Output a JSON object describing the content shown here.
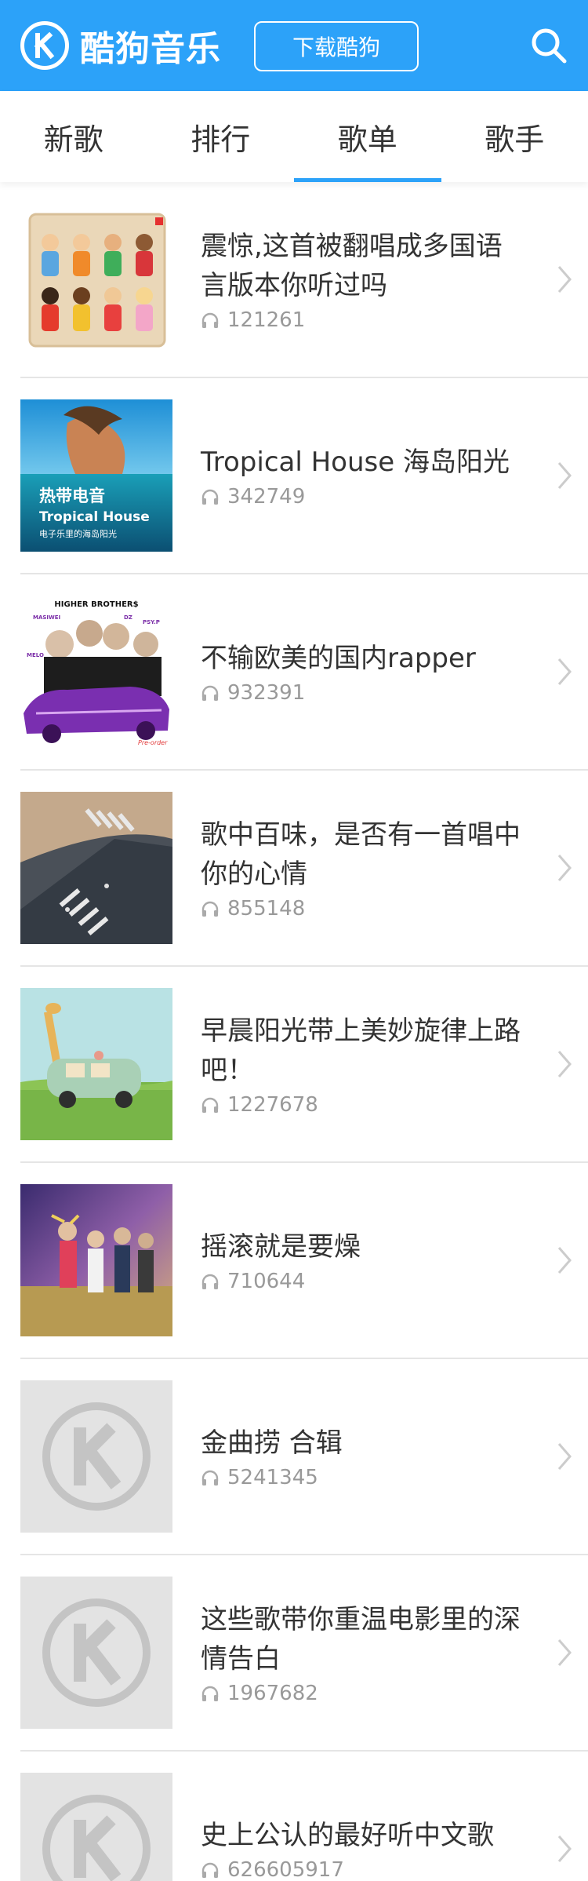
{
  "header": {
    "app_name": "酷狗音乐",
    "download_label": "下载酷狗",
    "brand_color": "#2ca2f9",
    "logo_icon": "kugou-logo-icon",
    "search_icon": "search-icon"
  },
  "tabs": [
    {
      "label": "新歌",
      "active": false
    },
    {
      "label": "排行",
      "active": false
    },
    {
      "label": "歌单",
      "active": true
    },
    {
      "label": "歌手",
      "active": false
    }
  ],
  "playlists": [
    {
      "title": "震惊,这首被翻唱成多国语言版本你听过吗",
      "plays": "121261",
      "cover": "cartoon-figures-cover"
    },
    {
      "title": "Tropical House 海岛阳光",
      "plays": "342749",
      "cover": "tropical-house-cover",
      "cover_text": {
        "line1": "热带电音",
        "line2": "Tropical House",
        "line3": "电子乐里的海岛阳光"
      }
    },
    {
      "title": "不输欧美的国内rapper",
      "plays": "932391",
      "cover": "higher-brothers-cover",
      "cover_text": {
        "top": "HIGHER BROTHER$",
        "n1": "MASIWEI",
        "n2": "DZ",
        "n3": "PSY.P",
        "n4": "MELO",
        "order": "Pre-order"
      }
    },
    {
      "title": "歌中百味，是否有一首唱中你的心情",
      "plays": "855148",
      "cover": "crosswalk-cover"
    },
    {
      "title": "早晨阳光带上美妙旋律上路吧！",
      "plays": "1227678",
      "cover": "giraffe-van-cover"
    },
    {
      "title": "摇滚就是要燥",
      "plays": "710644",
      "cover": "rock-band-cover"
    },
    {
      "title": "金曲捞 合辑",
      "plays": "5241345",
      "cover": "kugou-placeholder-cover"
    },
    {
      "title": "这些歌带你重温电影里的深情告白",
      "plays": "1967682",
      "cover": "kugou-placeholder-cover"
    },
    {
      "title": "史上公认的最好听中文歌",
      "plays": "626605917",
      "cover": "kugou-placeholder-cover"
    }
  ]
}
